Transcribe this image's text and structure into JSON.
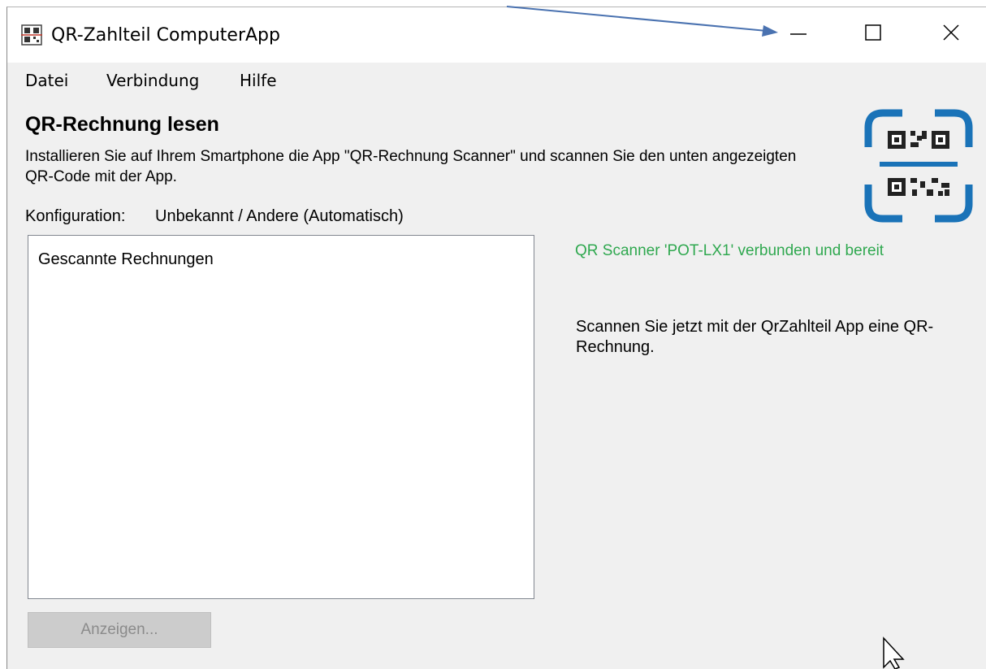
{
  "window": {
    "title": "QR-Zahlteil ComputerApp"
  },
  "menu": [
    "Datei",
    "Verbindung",
    "Hilfe"
  ],
  "main": {
    "heading": "QR-Rechnung lesen",
    "description": "Installieren Sie auf Ihrem Smartphone die App \"QR-Rechnung Scanner\" und scannen Sie den unten angezeigten QR-Code mit der App.",
    "config_label": "Konfiguration:",
    "config_value": "Unbekannt / Andere (Automatisch)",
    "list_header": "Gescannte Rechnungen",
    "view_button": "Anzeigen...",
    "status": "QR Scanner 'POT-LX1' verbunden und bereit",
    "instruction": "Scannen Sie jetzt mit der QrZahlteil App eine QR-Rechnung."
  },
  "colors": {
    "status_green": "#2fa84f",
    "logo_blue": "#1a73b8",
    "annotation_arrow": "#4a72b0"
  },
  "icons": [
    "app-qr-icon",
    "minimize-icon",
    "maximize-icon",
    "close-icon",
    "qr-scanner-logo",
    "mouse-cursor-icon"
  ]
}
